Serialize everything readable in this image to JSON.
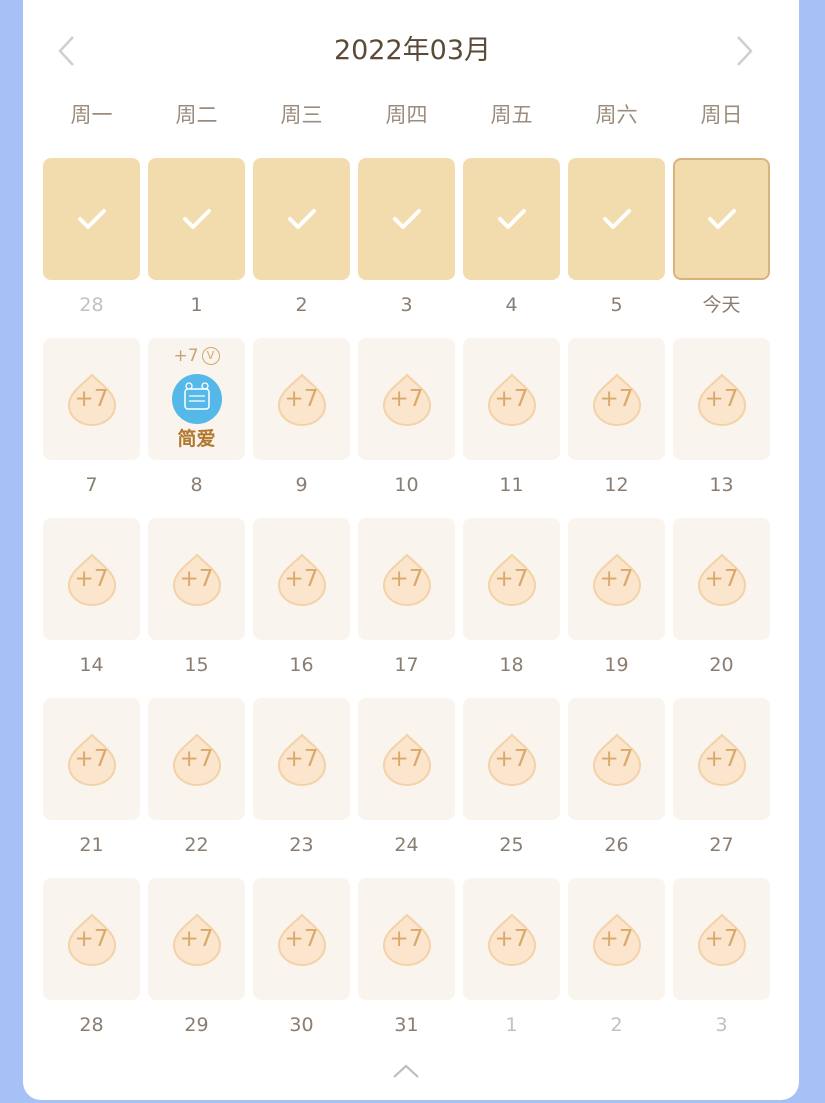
{
  "calendar": {
    "month_title": "2022年03月",
    "weekdays": [
      "周一",
      "周二",
      "周三",
      "周四",
      "周五",
      "周六",
      "周日"
    ],
    "weeks": [
      [
        {
          "num": "28",
          "state": "checked",
          "grey": true
        },
        {
          "num": "1",
          "state": "checked"
        },
        {
          "num": "2",
          "state": "checked"
        },
        {
          "num": "3",
          "state": "checked"
        },
        {
          "num": "4",
          "state": "checked"
        },
        {
          "num": "5",
          "state": "checked"
        },
        {
          "num": "今天",
          "state": "today"
        }
      ],
      [
        {
          "num": "7",
          "state": "reward",
          "reward": "+7"
        },
        {
          "num": "8",
          "state": "special",
          "reward": "+7",
          "badge_text": "简爱"
        },
        {
          "num": "9",
          "state": "reward",
          "reward": "+7"
        },
        {
          "num": "10",
          "state": "reward",
          "reward": "+7"
        },
        {
          "num": "11",
          "state": "reward",
          "reward": "+7"
        },
        {
          "num": "12",
          "state": "reward",
          "reward": "+7"
        },
        {
          "num": "13",
          "state": "reward",
          "reward": "+7"
        }
      ],
      [
        {
          "num": "14",
          "state": "reward",
          "reward": "+7"
        },
        {
          "num": "15",
          "state": "reward",
          "reward": "+7"
        },
        {
          "num": "16",
          "state": "reward",
          "reward": "+7"
        },
        {
          "num": "17",
          "state": "reward",
          "reward": "+7"
        },
        {
          "num": "18",
          "state": "reward",
          "reward": "+7"
        },
        {
          "num": "19",
          "state": "reward",
          "reward": "+7"
        },
        {
          "num": "20",
          "state": "reward",
          "reward": "+7"
        }
      ],
      [
        {
          "num": "21",
          "state": "reward",
          "reward": "+7"
        },
        {
          "num": "22",
          "state": "reward",
          "reward": "+7"
        },
        {
          "num": "23",
          "state": "reward",
          "reward": "+7"
        },
        {
          "num": "24",
          "state": "reward",
          "reward": "+7"
        },
        {
          "num": "25",
          "state": "reward",
          "reward": "+7"
        },
        {
          "num": "26",
          "state": "reward",
          "reward": "+7"
        },
        {
          "num": "27",
          "state": "reward",
          "reward": "+7"
        }
      ],
      [
        {
          "num": "28",
          "state": "reward",
          "reward": "+7"
        },
        {
          "num": "29",
          "state": "reward",
          "reward": "+7"
        },
        {
          "num": "30",
          "state": "reward",
          "reward": "+7"
        },
        {
          "num": "31",
          "state": "reward",
          "reward": "+7"
        },
        {
          "num": "1",
          "state": "reward",
          "reward": "+7",
          "grey": true
        },
        {
          "num": "2",
          "state": "reward",
          "reward": "+7",
          "grey": true
        },
        {
          "num": "3",
          "state": "reward",
          "reward": "+7",
          "grey": true
        }
      ]
    ]
  },
  "colors": {
    "background": "#a6c1f5",
    "checked_fill": "#f2dcad",
    "reward_fill": "#f9f4ee",
    "accent": "#d9a96b"
  },
  "icons": {
    "prev": "chevron-left-icon",
    "next": "chevron-right-icon",
    "check": "check-icon",
    "reward": "water-drop-icon",
    "collapse": "chevron-up-icon"
  }
}
